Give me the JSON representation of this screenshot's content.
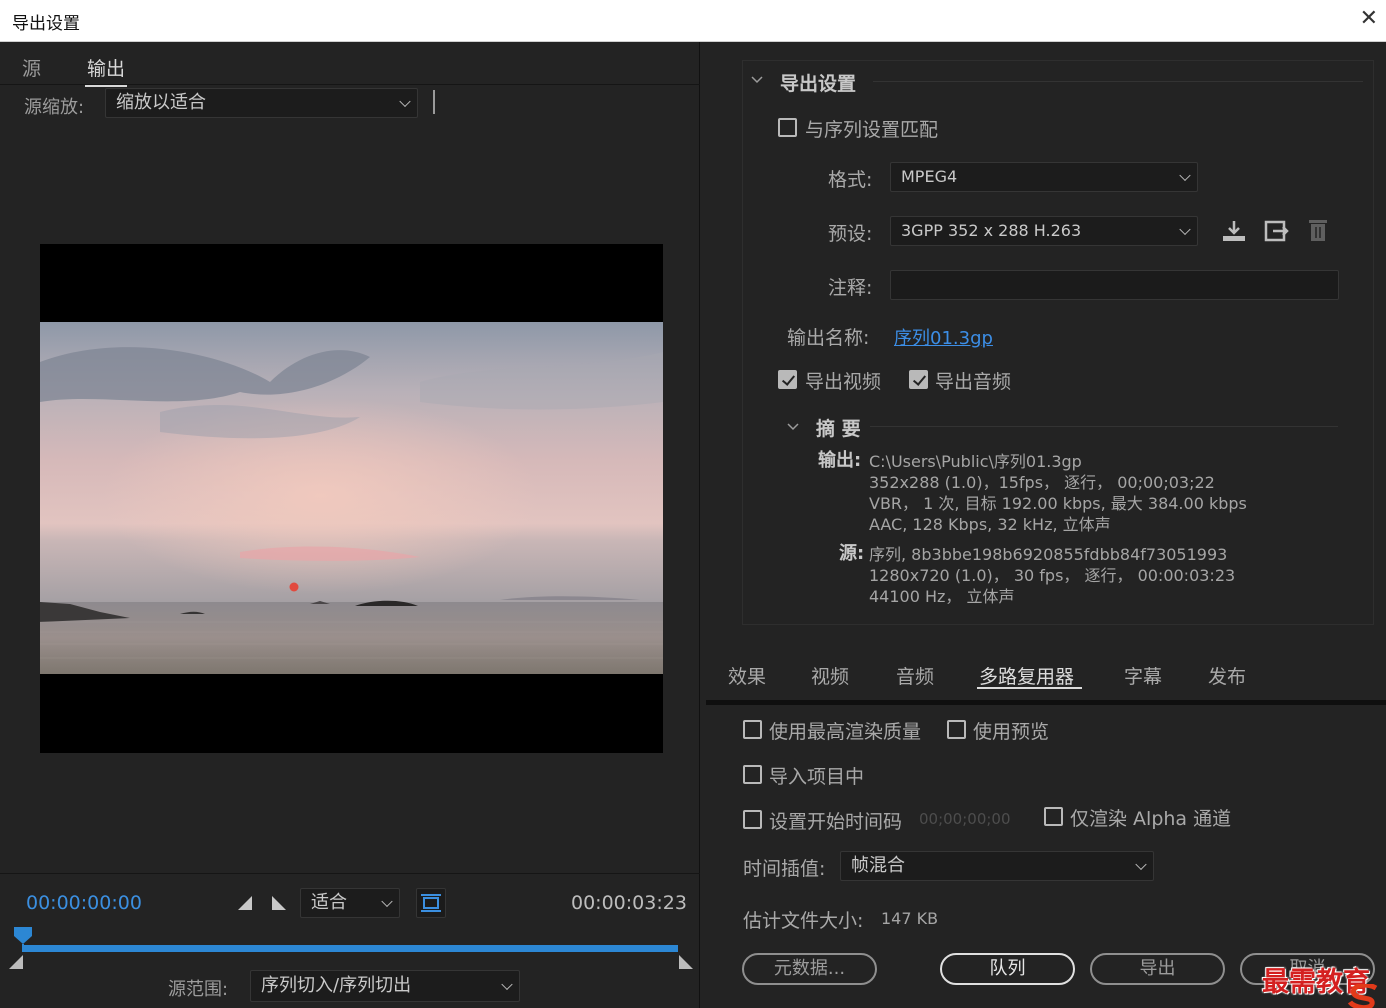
{
  "window": {
    "title": "导出设置",
    "close_glyph": "✕"
  },
  "left": {
    "tabs": [
      {
        "label": "源"
      },
      {
        "label": "输出"
      }
    ],
    "source_scale_label": "源缩放:",
    "source_scale_value": "缩放以适合",
    "timecode_start": "00:00:00:00",
    "timecode_end": "00:00:03:23",
    "zoom_value": "适合",
    "source_range_label": "源范围:",
    "source_range_value": "序列切入/序列切出",
    "playhead_progress": 0.0
  },
  "export_settings": {
    "section_title": "导出设置",
    "match_sequence_label": "与序列设置匹配",
    "match_sequence_checked": false,
    "format_label": "格式:",
    "format_value": "MPEG4",
    "preset_label": "预设:",
    "preset_value": "3GPP 352 x 288 H.263",
    "comments_label": "注释:",
    "comments_value": "",
    "output_name_label": "输出名称:",
    "output_name_value": "序列01.3gp",
    "export_video_label": "导出视频",
    "export_video_checked": true,
    "export_audio_label": "导出音频",
    "export_audio_checked": true,
    "summary_title": "摘 要",
    "summary_output_label": "输出:",
    "summary_output_lines": [
      "C:\\Users\\Public\\序列01.3gp",
      "352x288 (1.0)，15fps， 逐行， 00;00;03;22",
      "VBR， 1 次, 目标 192.00 kbps, 最大 384.00 kbps",
      "AAC, 128 Kbps, 32  kHz, 立体声"
    ],
    "summary_source_label": "源:",
    "summary_source_lines": [
      "序列, 8b3bbe198b6920855fdbb84f73051993",
      "1280x720 (1.0)， 30 fps， 逐行，  00:00:03:23",
      "44100 Hz， 立体声"
    ]
  },
  "bottom_tabs": [
    {
      "label": "效果"
    },
    {
      "label": "视频"
    },
    {
      "label": "音频"
    },
    {
      "label": "多路复用器"
    },
    {
      "label": "字幕"
    },
    {
      "label": "发布"
    }
  ],
  "options": {
    "max_render_quality_label": "使用最高渲染质量",
    "use_previews_label": "使用预览",
    "import_into_project_label": "导入项目中",
    "set_start_timecode_label": "设置开始时间码",
    "start_timecode_value": "00;00;00;00",
    "render_alpha_only_label": "仅渲染 Alpha 通道",
    "time_interpolation_label": "时间插值:",
    "time_interpolation_value": "帧混合",
    "estimated_size_label": "估计文件大小:",
    "estimated_size_value": "147 KB"
  },
  "buttons": {
    "metadata": "元数据...",
    "queue": "队列",
    "export": "导出",
    "cancel": "取消"
  },
  "watermark": {
    "text": "最需教育"
  },
  "colors": {
    "accent_blue": "#3b8fe0",
    "link_blue": "#3c8ee6",
    "watermark_red": "#d42020"
  }
}
